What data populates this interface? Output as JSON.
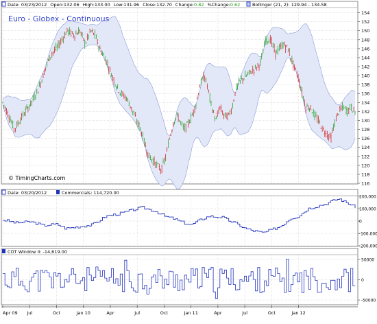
{
  "chart_data": [
    {
      "panel": "price",
      "type": "candlestick",
      "title": "Euro - Globex - Continuous",
      "watermark": "© TimingCharts.com",
      "header": {
        "date_label": "Date:",
        "date": "03/23/2012",
        "open_label": "Open:",
        "open": "132.06",
        "high_label": "High:",
        "high": "133.00",
        "low_label": "Low:",
        "low": "131.96",
        "close_label": "Close:",
        "close": "132.70",
        "change_label": "Change:",
        "change": "0.82",
        "pct_change_label": "%Change:",
        "pct_change": "0.62",
        "bollinger_label": "Bollinger (21, 2):",
        "bollinger_values": "129.94 - 134.58"
      },
      "ylim": [
        116,
        155
      ],
      "yticks": [
        116,
        118,
        120,
        122,
        124,
        126,
        128,
        130,
        132,
        134,
        136,
        138,
        140,
        142,
        144,
        146,
        148,
        150,
        152,
        154
      ],
      "x_range": [
        0,
        36
      ],
      "close_path": [
        [
          0,
          134
        ],
        [
          0.7,
          131
        ],
        [
          1.3,
          128
        ],
        [
          2.2,
          131
        ],
        [
          3.2,
          134
        ],
        [
          4,
          137
        ],
        [
          4.5,
          140
        ],
        [
          5,
          143
        ],
        [
          5.5,
          145
        ],
        [
          6,
          146
        ],
        [
          6.6,
          148
        ],
        [
          7.2,
          150
        ],
        [
          8,
          149
        ],
        [
          8.6,
          150
        ],
        [
          9.2,
          147
        ],
        [
          9.8,
          150
        ],
        [
          10.3,
          149
        ],
        [
          10.8,
          146
        ],
        [
          11.4,
          144
        ],
        [
          12,
          141
        ],
        [
          12.6,
          138
        ],
        [
          13.2,
          136
        ],
        [
          13.8,
          135
        ],
        [
          14.3,
          133
        ],
        [
          14.9,
          130
        ],
        [
          15.4,
          128
        ],
        [
          15.8,
          125
        ],
        [
          16.3,
          122
        ],
        [
          16.8,
          121
        ],
        [
          17.2,
          120
        ],
        [
          17.7,
          119
        ],
        [
          18.2,
          122
        ],
        [
          18.6,
          126
        ],
        [
          19.1,
          130
        ],
        [
          19.5,
          131
        ],
        [
          20.2,
          128
        ],
        [
          20.6,
          129
        ],
        [
          21.1,
          131
        ],
        [
          21.6,
          134
        ],
        [
          22,
          138
        ],
        [
          22.5,
          140
        ],
        [
          22.9,
          137
        ],
        [
          23.3,
          133
        ],
        [
          23.8,
          130
        ],
        [
          24.2,
          133
        ],
        [
          24.7,
          131
        ],
        [
          25.2,
          131
        ],
        [
          25.6,
          133
        ],
        [
          26,
          137
        ],
        [
          26.6,
          139
        ],
        [
          27.2,
          140
        ],
        [
          27.8,
          141
        ],
        [
          28.4,
          142
        ],
        [
          28.8,
          143
        ],
        [
          29.3,
          148
        ],
        [
          29.9,
          148
        ],
        [
          30.4,
          145
        ],
        [
          30.9,
          146
        ],
        [
          31.3,
          147
        ],
        [
          31.8,
          146
        ],
        [
          32.3,
          143
        ],
        [
          32.9,
          140
        ],
        [
          33.4,
          136
        ],
        [
          33.8,
          133
        ],
        [
          34.3,
          133
        ],
        [
          34.8,
          131
        ],
        [
          35.2,
          130
        ],
        [
          35.7,
          128
        ],
        [
          36.2,
          127
        ],
        [
          36.6,
          126
        ],
        [
          37.1,
          130
        ],
        [
          37.5,
          132
        ],
        [
          38,
          133
        ],
        [
          38.4,
          132
        ],
        [
          38.8,
          133
        ],
        [
          39.2,
          132
        ]
      ],
      "x_end": 39.3
    },
    {
      "panel": "commercials",
      "type": "line",
      "header": {
        "date_label": "Date:",
        "date": "03/20/2012",
        "series_label": "Commercials:",
        "series_value": "114,720.00"
      },
      "series_name": "Commercials",
      "ylim": [
        -200000,
        200000
      ],
      "yticks": [
        -200000,
        -100000,
        0,
        100000,
        200000
      ],
      "ytick_labels": [
        "-200,000",
        "-100,000",
        "0",
        "100,000",
        "200,000"
      ],
      "points": [
        [
          0,
          10000
        ],
        [
          1.5,
          -15000
        ],
        [
          3,
          -5000
        ],
        [
          4.5,
          -35000
        ],
        [
          6,
          -25000
        ],
        [
          7,
          -60000
        ],
        [
          8.5,
          -45000
        ],
        [
          10,
          -30000
        ],
        [
          11.5,
          40000
        ],
        [
          13,
          60000
        ],
        [
          14.5,
          90000
        ],
        [
          15.5,
          110000
        ],
        [
          17,
          80000
        ],
        [
          18,
          40000
        ],
        [
          19,
          20000
        ],
        [
          20,
          -10000
        ],
        [
          21,
          -30000
        ],
        [
          22,
          10000
        ],
        [
          23,
          40000
        ],
        [
          24.5,
          30000
        ],
        [
          25,
          10000
        ],
        [
          26,
          -20000
        ],
        [
          27,
          -60000
        ],
        [
          28,
          -80000
        ],
        [
          29,
          -95000
        ],
        [
          30,
          -70000
        ],
        [
          31,
          -40000
        ],
        [
          32,
          20000
        ],
        [
          33,
          40000
        ],
        [
          34,
          100000
        ],
        [
          35,
          120000
        ],
        [
          36,
          140000
        ],
        [
          37,
          170000
        ],
        [
          37.5,
          180000
        ],
        [
          38,
          160000
        ],
        [
          38.6,
          140000
        ],
        [
          39.2,
          114720
        ]
      ]
    },
    {
      "panel": "cot",
      "type": "line",
      "header": {
        "series_label": "COT Window II:",
        "series_value": "-14,619.00"
      },
      "series_name": "COT Window II",
      "ylim": [
        -60000,
        60000
      ],
      "yticks": [
        -50000,
        0,
        50000
      ],
      "ytick_labels": [
        "-50000",
        "0",
        "50000"
      ],
      "noise_seed": 11,
      "endpoint": -14619
    }
  ],
  "x_axis": {
    "labels": [
      {
        "text": "Apr 09",
        "x": 0
      },
      {
        "text": "Jul",
        "x": 3
      },
      {
        "text": "Oct",
        "x": 6
      },
      {
        "text": "Jan 10",
        "x": 9
      },
      {
        "text": "Apr",
        "x": 12
      },
      {
        "text": "Jul",
        "x": 15
      },
      {
        "text": "Oct",
        "x": 18
      },
      {
        "text": "Jan 11",
        "x": 21
      },
      {
        "text": "Apr",
        "x": 24
      },
      {
        "text": "Jul",
        "x": 27
      },
      {
        "text": "Oct",
        "x": 30
      },
      {
        "text": "Jan 12",
        "x": 33
      }
    ]
  },
  "colors": {
    "up": "#1a9a1a",
    "down": "#cc1a1a",
    "band_fill": "#e3e8f8",
    "band_line": "#8a9ad6",
    "series": "#2233bb",
    "title": "#3344cc",
    "change": "#1a9a1a",
    "grid": "#cfcfcf"
  }
}
